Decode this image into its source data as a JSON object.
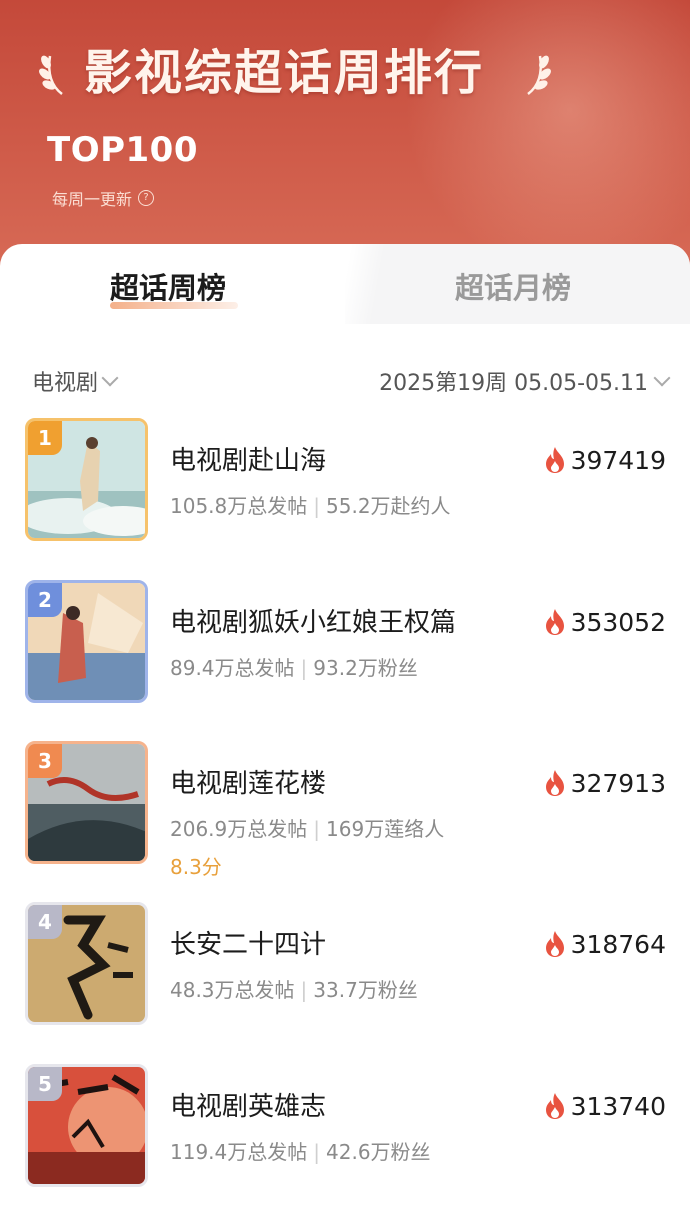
{
  "header": {
    "title": "影视综超话周排行",
    "subtitle": "TOP100",
    "update_note": "每周一更新",
    "help_icon": "question-circle-icon",
    "laurel_icon": "laurel-icon"
  },
  "tabs": [
    {
      "label": "超话周榜",
      "active": true
    },
    {
      "label": "超话月榜",
      "active": false
    }
  ],
  "filters": {
    "category": "电视剧",
    "period": "2025第19周 05.05-05.11"
  },
  "colors": {
    "header_red": "#c4493a",
    "rank1": "#f0a030",
    "rank2": "#6f8fdc",
    "rank3": "#f08a50",
    "rank_other": "#b8b8c8",
    "flame": "#e85340",
    "rating": "#e8a03b"
  },
  "items": [
    {
      "rank": "1",
      "title": "电视剧赴山海",
      "posts": "105.8万总发帖",
      "fans": "55.2万赴约人",
      "heat": "397419",
      "rating": ""
    },
    {
      "rank": "2",
      "title": "电视剧狐妖小红娘王权篇",
      "posts": "89.4万总发帖",
      "fans": "93.2万粉丝",
      "heat": "353052",
      "rating": ""
    },
    {
      "rank": "3",
      "title": "电视剧莲花楼",
      "posts": "206.9万总发帖",
      "fans": "169万莲络人",
      "heat": "327913",
      "rating": "8.3分"
    },
    {
      "rank": "4",
      "title": "长安二十四计",
      "posts": "48.3万总发帖",
      "fans": "33.7万粉丝",
      "heat": "318764",
      "rating": ""
    },
    {
      "rank": "5",
      "title": "电视剧英雄志",
      "posts": "119.4万总发帖",
      "fans": "42.6万粉丝",
      "heat": "313740",
      "rating": ""
    }
  ]
}
